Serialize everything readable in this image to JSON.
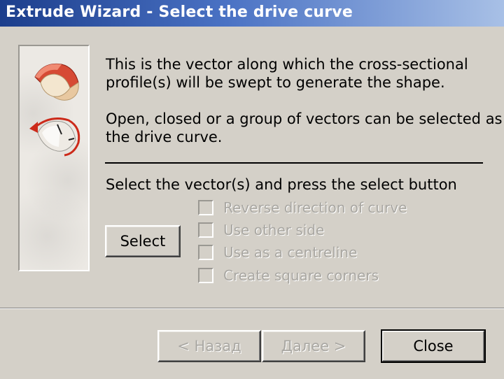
{
  "window": {
    "title": "Extrude Wizard - Select the drive curve"
  },
  "description": {
    "line1": "This is the vector along which the cross-sectional",
    "line2": "profile(s) will be swept to generate the shape.",
    "line3": "Open, closed or a group of vectors can be selected as",
    "line4": "the drive curve."
  },
  "instruction": "Select the vector(s) and press the select button",
  "select_button": "Select",
  "options": [
    {
      "label": "Reverse direction of curve",
      "checked": false,
      "enabled": false
    },
    {
      "label": "Use other side",
      "checked": false,
      "enabled": false
    },
    {
      "label": "Use as a centreline",
      "checked": false,
      "enabled": false
    },
    {
      "label": "Create square corners",
      "checked": false,
      "enabled": false
    }
  ],
  "footer": {
    "back_label": "< Назад",
    "next_label": "Далее >",
    "close_label": "Close"
  },
  "colors": {
    "title_gradient_start": "#1c3e8c",
    "title_gradient_end": "#a8c0e6",
    "dialog_bg": "#d4d0c8",
    "disabled_text": "#a9a7a2",
    "illustration_red": "#cc2a1a"
  },
  "icons": {
    "top_illustration": "swept-shape-icon",
    "bottom_illustration": "reverse-curve-arrow-icon"
  }
}
